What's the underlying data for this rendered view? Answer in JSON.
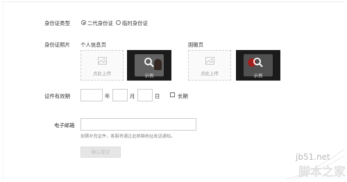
{
  "id_type": {
    "label": "身份证类型",
    "options": [
      {
        "label": "二代身份证",
        "selected": true
      },
      {
        "label": "临时身份证",
        "selected": false
      }
    ]
  },
  "id_photo": {
    "label": "身份证照片",
    "personal_side": {
      "title": "个人信息页",
      "upload_label": "点此上传",
      "sample_label": "示例"
    },
    "emblem_side": {
      "title": "国徽页",
      "upload_label": "点此上传",
      "sample_label": "示例"
    }
  },
  "validity": {
    "label": "证件有效期",
    "year_unit": "年",
    "month_unit": "月",
    "day_unit": "日",
    "long_term_label": "长期",
    "year_value": "",
    "month_value": "",
    "day_value": "",
    "long_term_checked": false
  },
  "email": {
    "label": "电子邮箱",
    "value": "",
    "hint": "如需补充证件，客服将通过此邮箱地址发送通知。"
  },
  "submit": {
    "label": "确认提交"
  },
  "watermark": {
    "domain": "jb51.net",
    "site_name": "脚本之家"
  }
}
